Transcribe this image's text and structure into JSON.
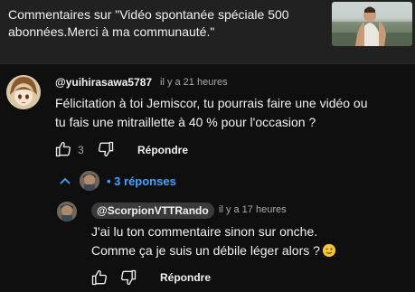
{
  "header": {
    "title": "Commentaires sur \"Vidéo spontanée spéciale 500 abonnées.Merci à ma communauté.\""
  },
  "comment": {
    "author": "@yuihirasawa5787",
    "time": "il y a 21 heures",
    "text_line1": "Félicitation à toi Jemiscor,  tu pourrais faire une vidéo ou",
    "text_line2": "tu fais une mitraillette à 40 % pour l'occasion  ?",
    "likes": "3",
    "reply_label": "Répondre"
  },
  "replies_toggle": {
    "label": "• 3 réponses"
  },
  "reply": {
    "author": "@ScorpionVTTRando",
    "time": "il y a 17 heures",
    "text_line1": "J'ai lu ton commentaire sinon sur onche.",
    "text_line2": "Comme ça je suis un débile léger alors ?",
    "reply_label": "Répondre"
  },
  "icons": {
    "like": "thumb-up-icon",
    "dislike": "thumb-down-icon",
    "collapse": "chevron-up-icon",
    "emoji": "winking-face-emoji"
  },
  "colors": {
    "background": "#0f0f0f",
    "header_bg": "#212121",
    "link": "#3ea6ff",
    "badge_bg": "#3a3a3a"
  }
}
